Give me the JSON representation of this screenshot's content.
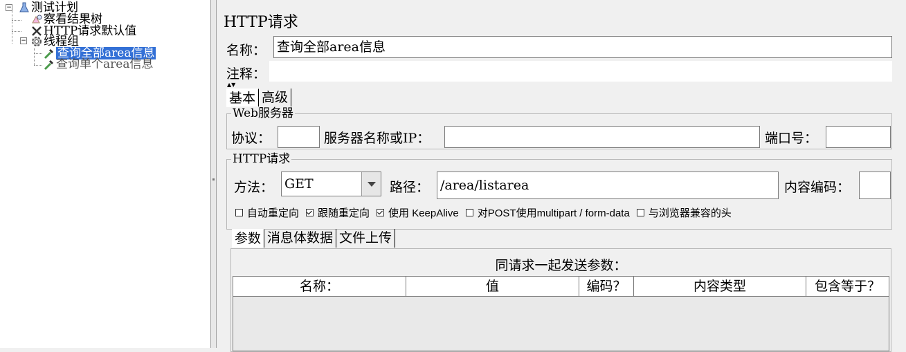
{
  "tree": {
    "root": "测试计划",
    "items": [
      {
        "label": "察看结果树",
        "icon": "listener-icon"
      },
      {
        "label": "HTTP请求默认值",
        "icon": "config-element-icon"
      },
      {
        "label": "线程组",
        "icon": "thread-group-gear-icon"
      }
    ],
    "thread_group_children": [
      {
        "label": "查询全部area信息",
        "selected": true
      },
      {
        "label": "查询单个area信息",
        "selected": false
      }
    ]
  },
  "panel": {
    "title": "HTTP请求",
    "name_label": "名称：",
    "name_value": "查询全部area信息",
    "comment_label": "注释：",
    "comment_value": ""
  },
  "tabs": {
    "basic": "基本",
    "advanced": "高级"
  },
  "web_server": {
    "group_title": "Web服务器",
    "protocol_label": "协议：",
    "protocol_value": "",
    "server_label": "服务器名称或IP：",
    "server_value": "",
    "port_label": "端口号：",
    "port_value": ""
  },
  "http_request": {
    "group_title": "HTTP请求",
    "method_label": "方法：",
    "method_value": "GET",
    "path_label": "路径：",
    "path_value": "/area/listarea",
    "encoding_label": "内容编码：",
    "encoding_value": ""
  },
  "options": [
    {
      "label": "自动重定向",
      "checked": false
    },
    {
      "label": "跟随重定向",
      "checked": true
    },
    {
      "label": "使用 KeepAlive",
      "checked": true
    },
    {
      "label": "对POST使用multipart / form-data",
      "checked": false
    },
    {
      "label": "与浏览器兼容的头",
      "checked": false
    }
  ],
  "sub_tabs": {
    "params": "参数",
    "body": "消息体数据",
    "files": "文件上传"
  },
  "params": {
    "caption": "同请求一起发送参数：",
    "columns": [
      "名称：",
      "值",
      "编码？",
      "内容类型",
      "包含等于？"
    ]
  },
  "colors": {
    "selection": "#3370d6",
    "panel_bg": "#f0f0f0"
  }
}
